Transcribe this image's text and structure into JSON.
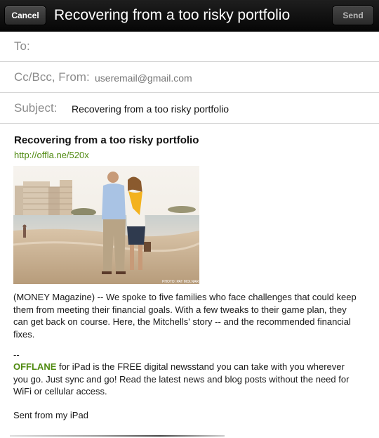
{
  "navbar": {
    "cancel_label": "Cancel",
    "title": "Recovering from a too risky portfolio",
    "send_label": "Send"
  },
  "header": {
    "to_label": "To:",
    "to_value": "",
    "cc_label": "Cc/Bcc, From:",
    "from_value": "useremail@gmail.com",
    "subject_label": "Subject:",
    "subject_value": "Recovering from a too risky portfolio"
  },
  "message": {
    "title": "Recovering from a too risky portfolio",
    "link": "http://offla.ne/520x",
    "photo_credit": "PHOTO: PAT MOLNAR",
    "paragraph1": "(MONEY Magazine) -- We spoke to five families who face challenges that could keep them from meeting their financial goals. With a few tweaks to their game plan, they can get back on course. Here, the Mitchells' story -- and the recommended financial fixes.",
    "signature_separator": "--",
    "brand": "OFFLANE",
    "paragraph2_rest": " for iPad is the FREE digital newsstand you can take with you wherever you go.  Just sync and go!  Read the latest news and blog posts without the need for WiFi or cellular access.",
    "sent_from": "Sent from my iPad"
  },
  "colors": {
    "link_green": "#4f8a10",
    "navbar_black": "#0d0d0d"
  }
}
